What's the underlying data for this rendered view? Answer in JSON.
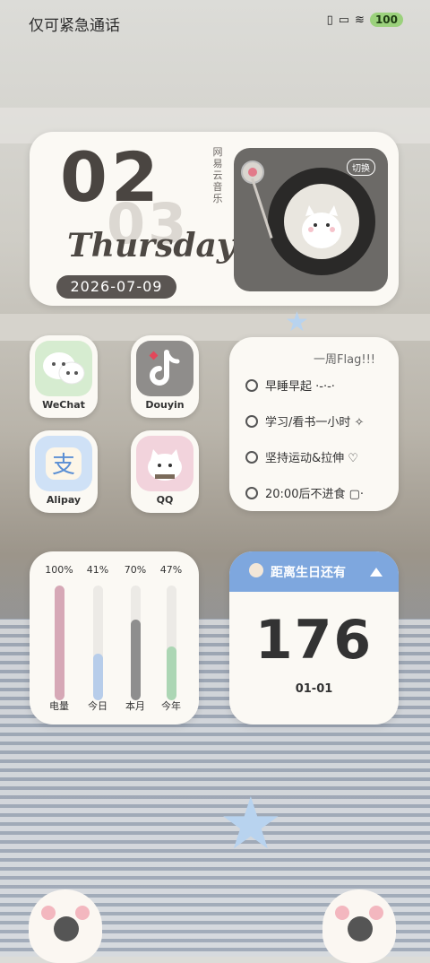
{
  "status_bar": {
    "carrier": "仅可紧急通话",
    "battery": "100"
  },
  "clock_widget": {
    "hour": "02",
    "minute": "03",
    "weekday": "Thursday",
    "date": "2026-07-09",
    "music_app": "网易云音乐",
    "switch_label": "切换"
  },
  "apps": [
    {
      "label": "WeChat",
      "color": "#cfe6c6"
    },
    {
      "label": "Douyin",
      "color": "#8f8d8b"
    },
    {
      "label": "Alipay",
      "color": "#c7dcf4"
    },
    {
      "label": "QQ",
      "color": "#f2d3dc"
    }
  ],
  "flag_widget": {
    "title": "一周Flag!!!",
    "items": [
      "早睡早起 ·-·-·",
      "学习/看书一小时 ✧",
      "坚持运动&拉伸 ♡",
      "20:00后不进食 ▢·"
    ]
  },
  "progress_widget": {
    "items": [
      {
        "label": "电量",
        "percent": "100%",
        "value": 1.0,
        "color": "#d6a8b6"
      },
      {
        "label": "今日",
        "percent": "41%",
        "value": 0.41,
        "color": "#b7cdea"
      },
      {
        "label": "本月",
        "percent": "70%",
        "value": 0.7,
        "color": "#8e8e8e"
      },
      {
        "label": "今年",
        "percent": "47%",
        "value": 0.47,
        "color": "#acd6b4"
      }
    ]
  },
  "birthday_widget": {
    "title": "距离生日还有",
    "days": "176",
    "date": "01-01"
  }
}
